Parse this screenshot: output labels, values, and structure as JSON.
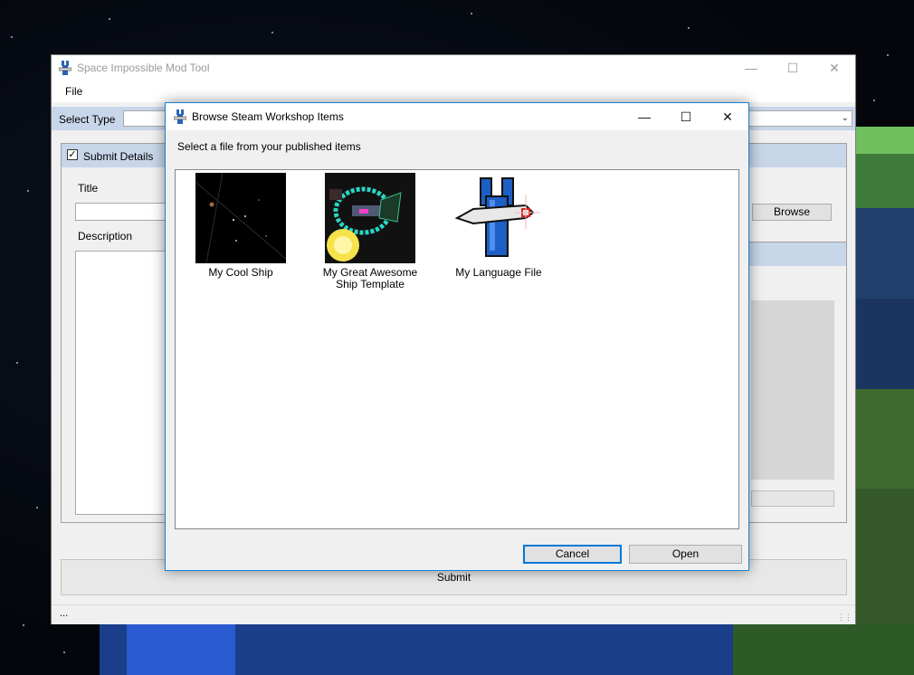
{
  "main_window": {
    "title": "Space Impossible Mod Tool",
    "app_icon": "wrench-app-icon",
    "controls": {
      "minimize": "—",
      "maximize": "☐",
      "close": "✕"
    },
    "menu": [
      {
        "label": "File"
      }
    ],
    "select_type": {
      "label": "Select Type",
      "value": ""
    },
    "submit_details": {
      "checkbox_label": "Submit Details",
      "checked": true,
      "title_label": "Title",
      "title_value": "",
      "description_label": "Description",
      "description_value": "",
      "browse_label": "Browse"
    },
    "submit_label": "Submit",
    "status_text": "..."
  },
  "dialog": {
    "title": "Browse Steam Workshop Items",
    "app_icon": "wrench-app-icon",
    "controls": {
      "minimize": "—",
      "maximize": "☐",
      "close": "✕"
    },
    "prompt": "Select a file from your published items",
    "items": [
      {
        "label": "My Cool Ship",
        "thumb": "starfield-thumbnail"
      },
      {
        "label": "My Great Awesome Ship Template",
        "thumb": "ship-thumbnail"
      },
      {
        "label": "My Language File",
        "thumb": "wrench-thumbnail"
      }
    ],
    "cancel_label": "Cancel",
    "open_label": "Open"
  },
  "colors": {
    "accent": "#0078d7",
    "header_band": "#c8d6ea",
    "window_bg": "#f0f0f0"
  }
}
